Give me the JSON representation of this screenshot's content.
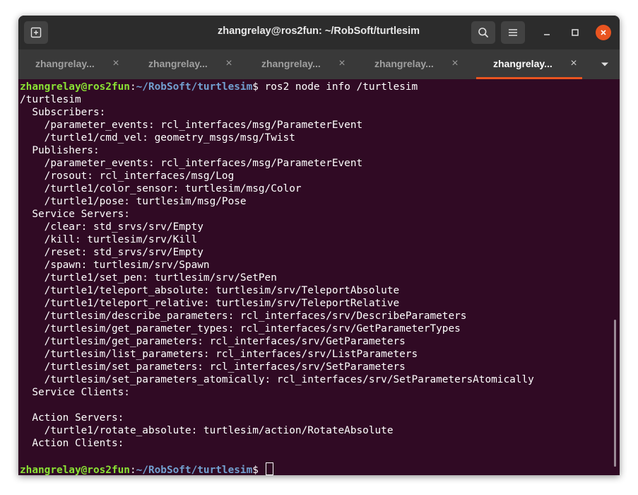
{
  "window": {
    "title": "zhangrelay@ros2fun: ~/RobSoft/turtlesim"
  },
  "tabs": [
    {
      "label": "zhangrelay...",
      "active": false
    },
    {
      "label": "zhangrelay...",
      "active": false
    },
    {
      "label": "zhangrelay...",
      "active": false
    },
    {
      "label": "zhangrelay...",
      "active": false
    },
    {
      "label": "zhangrelay...",
      "active": true
    }
  ],
  "tab_close_glyph": "×",
  "colors": {
    "terminal_bg": "#300a24",
    "prompt_user": "#8ae234",
    "prompt_path": "#729fcf",
    "accent": "#e95420"
  },
  "icons": {
    "new_tab": "new-tab-icon",
    "search": "search-icon",
    "menu": "hamburger-menu-icon",
    "minimize": "minimize-icon",
    "maximize": "maximize-icon",
    "close": "close-icon",
    "tab_list": "chevron-down-icon"
  },
  "terminal": {
    "prompt": {
      "user_host": "zhangrelay@ros2fun",
      "separator": ":",
      "path": "~/RobSoft/turtlesim",
      "symbol": "$"
    },
    "command": " ros2 node info /turtlesim",
    "output": [
      "/turtlesim",
      "  Subscribers:",
      "    /parameter_events: rcl_interfaces/msg/ParameterEvent",
      "    /turtle1/cmd_vel: geometry_msgs/msg/Twist",
      "  Publishers:",
      "    /parameter_events: rcl_interfaces/msg/ParameterEvent",
      "    /rosout: rcl_interfaces/msg/Log",
      "    /turtle1/color_sensor: turtlesim/msg/Color",
      "    /turtle1/pose: turtlesim/msg/Pose",
      "  Service Servers:",
      "    /clear: std_srvs/srv/Empty",
      "    /kill: turtlesim/srv/Kill",
      "    /reset: std_srvs/srv/Empty",
      "    /spawn: turtlesim/srv/Spawn",
      "    /turtle1/set_pen: turtlesim/srv/SetPen",
      "    /turtle1/teleport_absolute: turtlesim/srv/TeleportAbsolute",
      "    /turtle1/teleport_relative: turtlesim/srv/TeleportRelative",
      "    /turtlesim/describe_parameters: rcl_interfaces/srv/DescribeParameters",
      "    /turtlesim/get_parameter_types: rcl_interfaces/srv/GetParameterTypes",
      "    /turtlesim/get_parameters: rcl_interfaces/srv/GetParameters",
      "    /turtlesim/list_parameters: rcl_interfaces/srv/ListParameters",
      "    /turtlesim/set_parameters: rcl_interfaces/srv/SetParameters",
      "    /turtlesim/set_parameters_atomically: rcl_interfaces/srv/SetParametersAtomically",
      "  Service Clients:",
      "",
      "  Action Servers:",
      "    /turtle1/rotate_absolute: turtlesim/action/RotateAbsolute",
      "  Action Clients:",
      ""
    ]
  }
}
